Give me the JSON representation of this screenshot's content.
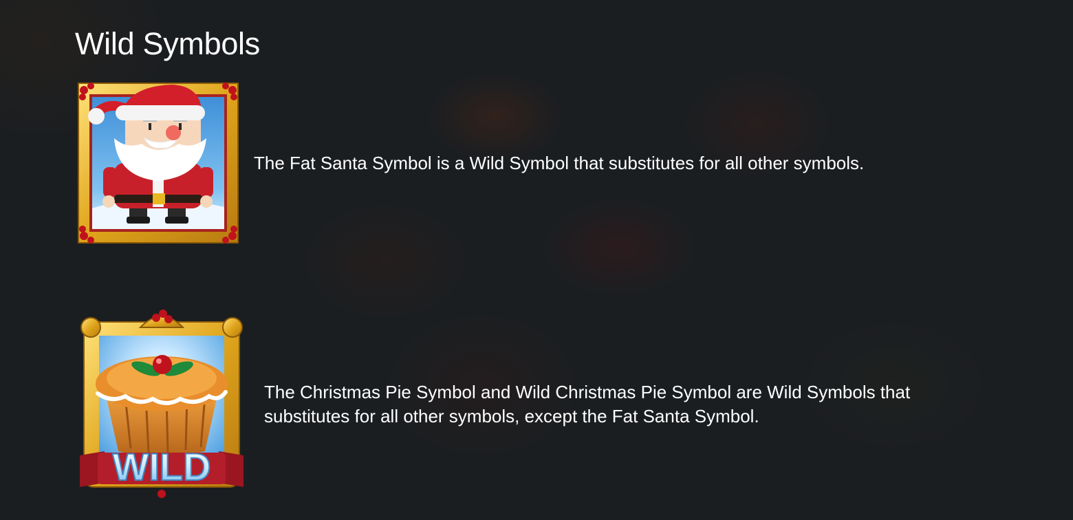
{
  "heading": "Wild Symbols",
  "symbols": [
    {
      "icon": "fat-santa-symbol",
      "description": "The Fat Santa Symbol is a Wild Symbol that substitutes for all other symbols."
    },
    {
      "icon": "wild-christmas-pie-symbol",
      "badge_text": "WILD",
      "description": "The Christmas Pie Symbol and Wild Christmas Pie Symbol are Wild Symbols that substitutes for all other symbols, except the Fat Santa Symbol."
    }
  ],
  "colors": {
    "background": "#1b1e21",
    "text": "#ffffff",
    "gold_frame": "#e0a51c",
    "santa_red": "#c8202a",
    "wild_banner": "#b31e2a"
  }
}
